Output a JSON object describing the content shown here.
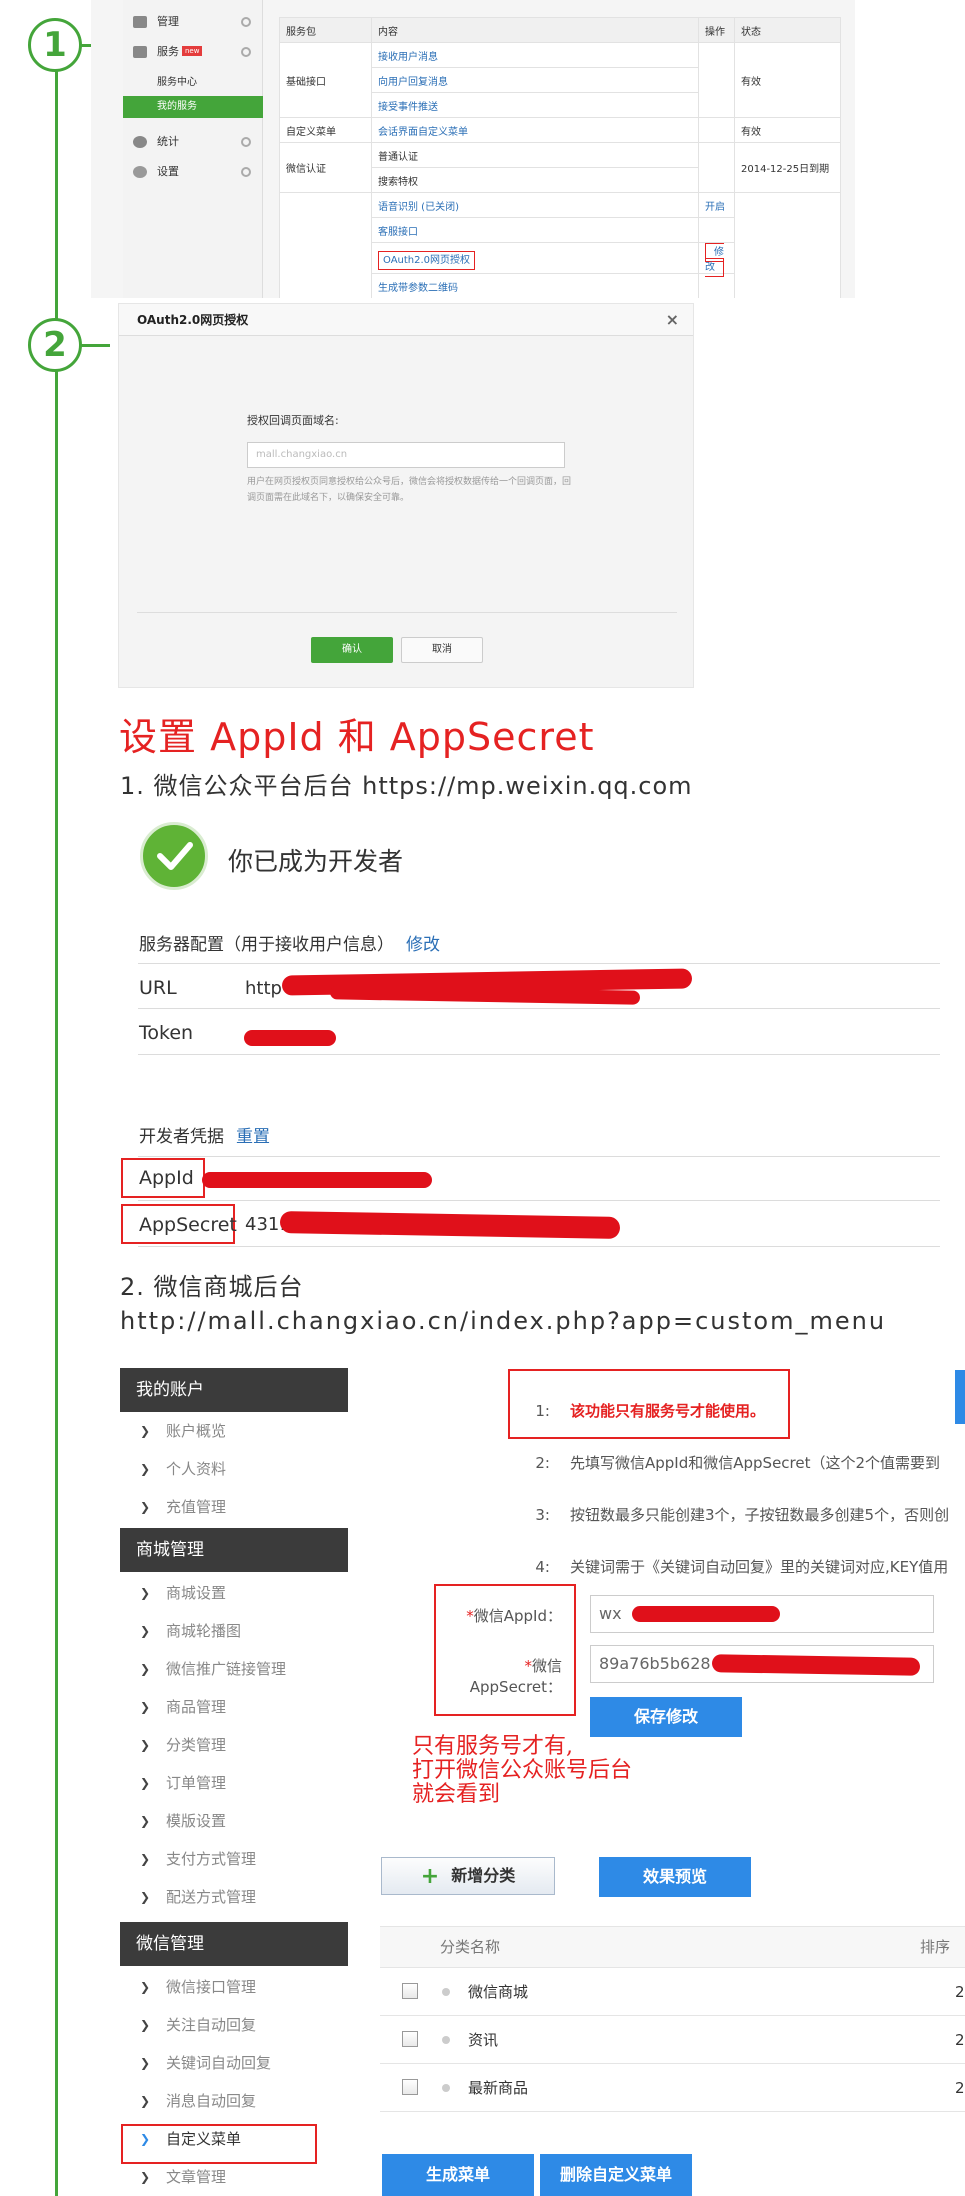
{
  "steps": {
    "one": "1",
    "two": "2"
  },
  "panel1": {
    "sidebar": {
      "manage": "管理",
      "service": "服务",
      "service_badge": "new",
      "service_center": "服务中心",
      "my_services": "我的服务",
      "stats": "统计",
      "settings": "设置"
    },
    "table": {
      "headers": [
        "服务包",
        "内容",
        "操作",
        "状态"
      ],
      "rows": [
        {
          "pkg": "基础接口",
          "items": [
            "接收用户消息",
            "向用户回复消息",
            "接受事件推送"
          ],
          "status": "有效"
        },
        {
          "pkg": "自定义菜单",
          "items": [
            "会话界面自定义菜单"
          ],
          "status": "有效"
        },
        {
          "pkg": "微信认证",
          "items": [
            "普通认证",
            "搜索特权"
          ],
          "status": "2014-12-25日到期"
        },
        {
          "pkg": "",
          "items": [
            "语音识别 (已关闭)"
          ],
          "action": "开启"
        },
        {
          "pkg": "",
          "items": [
            "客服接口"
          ]
        },
        {
          "pkg": "",
          "items": [
            "OAuth2.0网页授权"
          ],
          "action": "修改"
        },
        {
          "pkg": "",
          "items": [
            "生成带参数二维码"
          ]
        }
      ]
    }
  },
  "dialog": {
    "title": "OAuth2.0网页授权",
    "close": "×",
    "label": "授权回调页面域名:",
    "input_value": "mall.changxiao.cn",
    "help": "用户在网页授权页同意授权给公众号后，微信会将授权数据传给一个回调页面，回调页面需在此域名下，以确保安全可靠。",
    "ok": "确认",
    "cancel": "取消"
  },
  "heading": "设置 AppId 和 AppSecret",
  "step_text_1": "1. 微信公众平台后台 https://mp.weixin.qq.com",
  "developer": {
    "title": "你已成为开发者",
    "server_config": "服务器配置（用于接收用户信息）",
    "modify": "修改",
    "url_key": "URL",
    "url_val": "http",
    "token_key": "Token",
    "cred_title": "开发者凭据",
    "reset": "重置",
    "appid_key": "AppId",
    "appsecret_key": "AppSecret",
    "appsecret_val": "4311"
  },
  "step_text_2": "2. 微信商城后台",
  "step_text_3": "http://mall.changxiao.cn/index.php?app=custom_menu",
  "mall": {
    "sections": [
      {
        "title": "我的账户",
        "items": [
          "账户概览",
          "个人资料",
          "充值管理"
        ]
      },
      {
        "title": "商城管理",
        "items": [
          "商城设置",
          "商城轮播图",
          "微信推广链接管理",
          "商品管理",
          "分类管理",
          "订单管理",
          "模版设置",
          "支付方式管理",
          "配送方式管理"
        ]
      },
      {
        "title": "微信管理",
        "items": [
          "微信接口管理",
          "关注自动回复",
          "关键词自动回复",
          "消息自动回复",
          "自定义菜单",
          "文章管理"
        ]
      }
    ],
    "notes": [
      {
        "n": "1:",
        "text": "该功能只有服务号才能使用。"
      },
      {
        "n": "2:",
        "text": "先填写微信AppId和微信AppSecret（这个2个值需要到"
      },
      {
        "n": "3:",
        "text": "按钮数最多只能创建3个，子按钮数最多创建5个，否则创"
      },
      {
        "n": "4:",
        "text": "关键词需于《关键词自动回复》里的关键词对应,KEY值用"
      }
    ],
    "appid_label": "微信AppId：",
    "appid_value": "wx",
    "appsecret_label": "微信AppSecret：",
    "appsecret_value": "89a76b5b628",
    "required_mark": "*",
    "save": "保存修改",
    "handwritten": [
      "只有服务号才有,",
      "打开微信公众账号后台",
      "就会看到"
    ],
    "add_category": "新增分类",
    "add_icon": "+",
    "preview": "效果预览",
    "col_name": "分类名称",
    "col_sort": "排序",
    "categories": [
      {
        "name": "微信商城",
        "sort": "2"
      },
      {
        "name": "资讯",
        "sort": "2"
      },
      {
        "name": "最新商品",
        "sort": "2"
      }
    ],
    "generate": "生成菜单",
    "delete": "删除自定义菜单"
  }
}
